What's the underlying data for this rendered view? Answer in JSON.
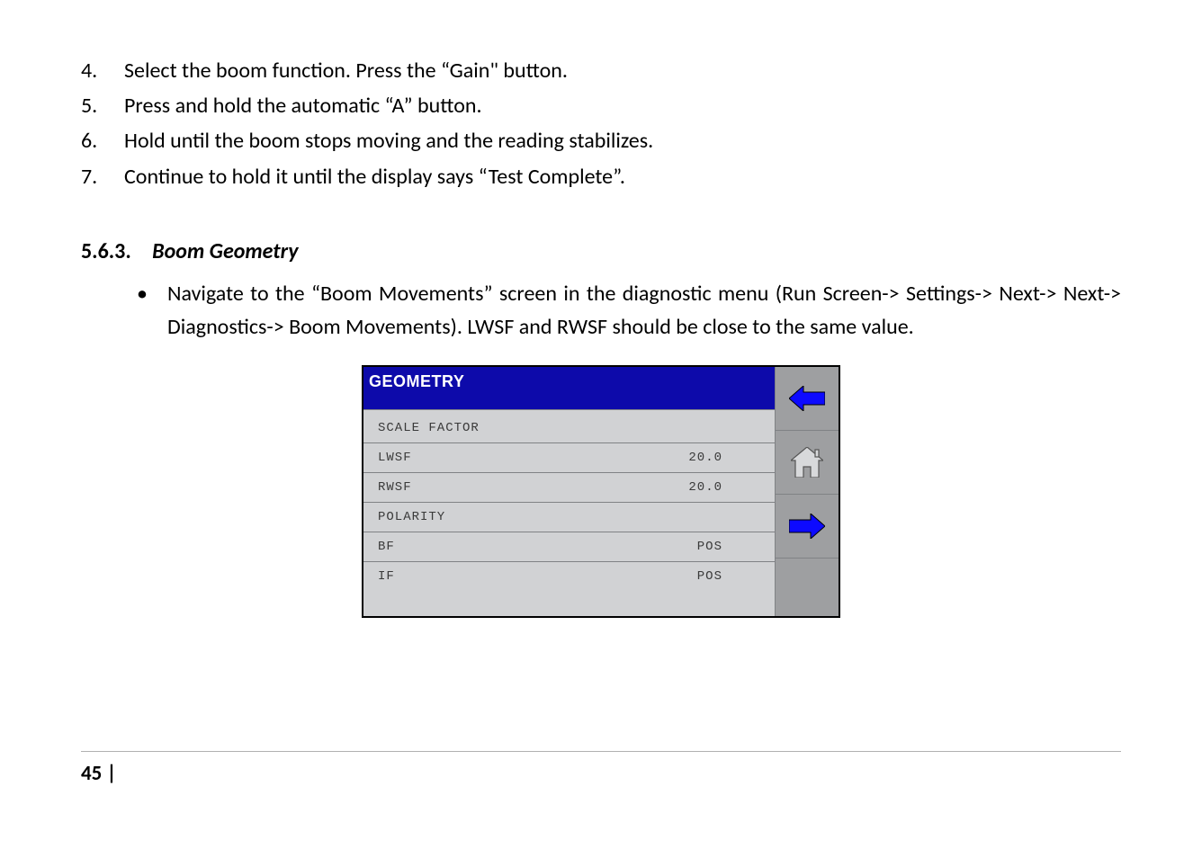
{
  "steps": [
    {
      "num": "4.",
      "text": "Select the boom function.  Press the “Gain\" button."
    },
    {
      "num": "5.",
      "text": "Press and hold the automatic “A” button."
    },
    {
      "num": "6.",
      "text": "Hold until the boom stops moving and the reading stabilizes."
    },
    {
      "num": "7.",
      "text": "Continue to hold it until the display says “Test Complete”."
    }
  ],
  "section": {
    "number": "5.6.3.",
    "title": "Boom Geometry"
  },
  "bullet": "Navigate to the “Boom Movements” screen in the diagnostic menu (Run Screen-> Settings-> Next-> Next-> Diagnostics-> Boom Movements). LWSF and RWSF should be close to the same value.",
  "device": {
    "header": "GEOMETRY",
    "scale_label": "SCALE FACTOR",
    "lwsf": {
      "label": "LWSF",
      "value": "20.0"
    },
    "rwsf": {
      "label": "RWSF",
      "value": "20.0"
    },
    "polarity_label": "POLARITY",
    "bf": {
      "label": "BF",
      "value": "POS"
    },
    "if": {
      "label": "IF",
      "value": "POS"
    }
  },
  "page_number": "45 |"
}
